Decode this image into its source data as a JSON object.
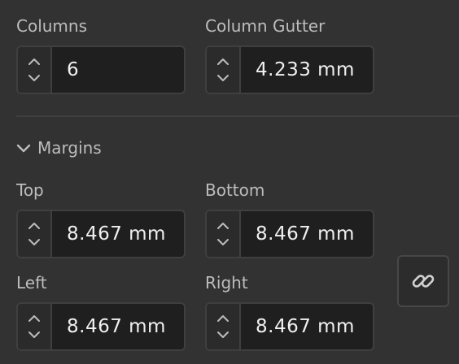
{
  "columns": {
    "label": "Columns",
    "value": "6"
  },
  "column_gutter": {
    "label": "Column Gutter",
    "value": "4.233 mm"
  },
  "margins": {
    "title": "Margins",
    "expanded": true,
    "top": {
      "label": "Top",
      "value": "8.467 mm"
    },
    "bottom": {
      "label": "Bottom",
      "value": "8.467 mm"
    },
    "left": {
      "label": "Left",
      "value": "8.467 mm"
    },
    "right": {
      "label": "Right",
      "value": "8.467 mm"
    },
    "link_icon": "link-icon"
  },
  "colors": {
    "background": "#323232",
    "field_background": "#1f1f1f",
    "border": "#3f3f3f",
    "label_text": "#bdbdbd",
    "value_text": "#f0f0f0"
  }
}
